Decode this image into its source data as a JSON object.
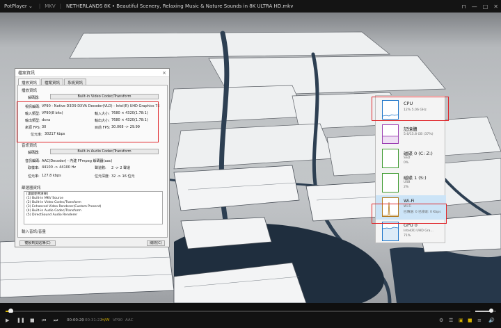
{
  "titlebar": {
    "app": "PotPlayer",
    "codec": "MKV",
    "title": "NETHERLANDS 8K • Beautiful Scenery, Relaxing Music & Nature Sounds in 8K ULTRA HD.mkv",
    "min_icon": "minimize-icon",
    "max_icon": "maximize-icon",
    "close_icon": "close-icon"
  },
  "dialog": {
    "title": "檔案資訊",
    "close": "×",
    "tabs": [
      "播放資訊",
      "檔案資訊",
      "系統資訊"
    ],
    "video": {
      "section": "播放資訊",
      "decoder_label": "解碼器:",
      "decoder_button": "Built-in Video Codec/Transform",
      "codec_label": "視訊編碼:",
      "codec_value": "VP90 - Native D3D9 DXVA Decoder(VLD) - Intel(R) UHD Graphics 75",
      "input_type_label": "輸入類型:",
      "input_type_value": "VP90(8 bits)",
      "input_size_label": "輸入大小:",
      "input_size_value": "7680 × 4320(1.78:1)",
      "output_type_label": "輸出類型:",
      "output_type_value": "dxva",
      "output_size_label": "輸出大小:",
      "output_size_value": "7680 × 4320(1.78:1)",
      "source_fps_label": "來源 FPS:",
      "source_fps_value": "30",
      "target_fps_label": "目前 FPS:",
      "target_fps_value": "30.068 -> 29.99",
      "bitrate_label": "位元率:",
      "bitrate_value": "30217 kbps"
    },
    "audio": {
      "section": "音訊資訊",
      "decoder_label": "解碼器:",
      "decoder_button": "Built-in Audio Codec/Transform",
      "codec_label": "音訊編碼:",
      "codec_value": "AAC(Decoder) - 內建 FFmpeg 解碼器(aac)",
      "samplerate_label": "取樣率:",
      "samplerate_value": "44100 -> 44100 Hz",
      "channels_label": "聲道數:",
      "channels_value": "2 -> 2 聲道",
      "bitrate_label": "位元率:",
      "bitrate_value": "127.8 kbps",
      "depth_label": "位元深度:",
      "depth_value": "32 -> 16 位元"
    },
    "filters": {
      "section": "篩選器資訊",
      "items": [
        "[濾鏡使用清單]",
        "(1) Built-in MKV Source",
        "(2) Built-in Video Codec/Transform",
        "(3) Enhanced Video Renderer(Custom Present)",
        "(4) Built-in Audio Codec/Transform",
        "(5) DirectSound Audio Renderer"
      ]
    },
    "bottom": {
      "section": "輸入音訊/音量",
      "copy_button": "複製到剪貼簿(C)",
      "close_button": "關閉(C)"
    }
  },
  "taskmanager": {
    "items": [
      {
        "name": "CPU",
        "sub1": "12% 5.06 GHz",
        "sub2": "",
        "color": "#1a73c8"
      },
      {
        "name": "記憶體",
        "sub1": "5.6/15.8 GB (37%)",
        "sub2": "",
        "color": "#9b3fb3"
      },
      {
        "name": "磁碟 0 (C: Z:)",
        "sub1": "SSD",
        "sub2": "0%",
        "color": "#3c9a2e"
      },
      {
        "name": "磁碟 1 (S:)",
        "sub1": "USB",
        "sub2": "2%",
        "color": "#3c9a2e"
      },
      {
        "name": "Wi-Fi",
        "sub1": "Wi-Fi",
        "sub2": "已傳送: 0 已接收: 0 Kbps",
        "color": "#b37818"
      },
      {
        "name": "GPU 0",
        "sub1": "Intel(R) UHD Gra...",
        "sub2": "71%",
        "color": "#1a73c8"
      }
    ]
  },
  "controls": {
    "time_current": "00:00:20",
    "time_total": "00:31:22",
    "hw_label": "H/W",
    "codec_label": "VP90",
    "audio_label": "AAC",
    "progress": 0.011,
    "volume": 0.75,
    "play_icon": "play-icon",
    "pause_icon": "pause-icon",
    "stop_icon": "stop-icon",
    "prev_icon": "previous-icon",
    "next_icon": "next-icon",
    "eject_icon": "eject-icon",
    "highlight_color": "#e0272b",
    "seek_color": "#d7b300"
  }
}
